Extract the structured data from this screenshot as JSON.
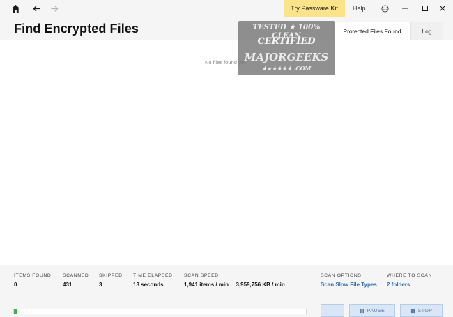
{
  "window": {
    "try_button": "Try Passware Kit",
    "help": "Help"
  },
  "header": {
    "title": "Find Encrypted Files",
    "tabs": [
      {
        "label": "Protected Files Found",
        "active": true
      },
      {
        "label": "Log",
        "active": false
      }
    ]
  },
  "content": {
    "empty_message": "No files found yet"
  },
  "watermark": {
    "line1": "TESTED ★ 100% CLEAN",
    "line2": "CERTIFIED",
    "line3": "MAJORGEEKS",
    "line4": "★★★★★★ .COM"
  },
  "stats": {
    "items_found": {
      "label": "ITEMS FOUND",
      "value": "0"
    },
    "scanned": {
      "label": "SCANNED",
      "value": "431"
    },
    "skipped": {
      "label": "SKIPPED",
      "value": "3"
    },
    "time_elapsed": {
      "label": "TIME ELAPSED",
      "value": "13 seconds"
    },
    "scan_speed": {
      "label": "SCAN SPEED",
      "items": "1,941 items / min",
      "kb": "3,959,756 KB / min"
    },
    "scan_options": {
      "label": "SCAN OPTIONS",
      "value": "Scan Slow File Types"
    },
    "where_to_scan": {
      "label": "WHERE TO SCAN",
      "value": "2 folders"
    }
  },
  "bottom": {
    "pause_label": "PAUSE",
    "stop_label": "STOP"
  },
  "colors": {
    "accent_link": "#2f6db5",
    "try_button_bg": "#fbe38a",
    "progress": "#3fb14f"
  },
  "icons": [
    "home-icon",
    "back-arrow-icon",
    "forward-arrow-icon",
    "smiley-icon",
    "minimize-icon",
    "maximize-icon",
    "close-icon",
    "pause-icon",
    "stop-icon"
  ]
}
